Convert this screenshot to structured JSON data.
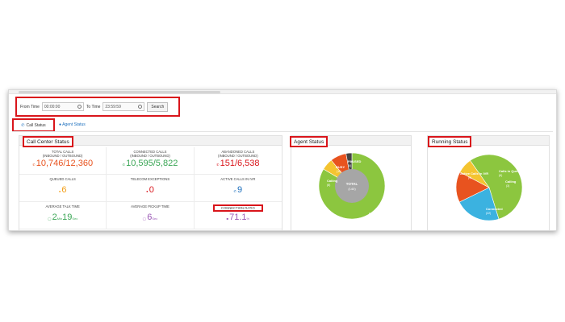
{
  "filter": {
    "from_label": "From Time",
    "from_value": "00:00:00",
    "to_label": "To Time",
    "to_value": "23:59:59",
    "search_label": "Search"
  },
  "tabs": [
    {
      "label": "Call Status",
      "icon": "phone-icon",
      "active": true
    },
    {
      "label": "Agent Status",
      "icon": "user-icon",
      "active": false
    }
  ],
  "call_center": {
    "title": "Call Center Status",
    "cells": [
      {
        "title": "TOTAL CALLS",
        "subtitle": "(INBOUND / OUTBOUND)",
        "value": "10,746/12,360",
        "color": "#e8531f",
        "icon": "phone-icon"
      },
      {
        "title": "CONNECTED CALLS",
        "subtitle": "(INBOUND / OUTBOUND)",
        "value": "10,595/5,822",
        "color": "#3aa655",
        "icon": "phone-icon"
      },
      {
        "title": "ABANDONED CALLS",
        "subtitle": "(INBOUND / OUTBOUND)",
        "value": "151/6,538",
        "color": "#d9151b",
        "icon": "phone-icon"
      },
      {
        "title": "QUEUED CALLS",
        "subtitle": "",
        "value": "6",
        "color": "#f39c12",
        "icon": "queue-icon"
      },
      {
        "title": "TELECOM EXCEPTIONS",
        "subtitle": "",
        "value": "0",
        "color": "#d9151b",
        "icon": "alert-icon"
      },
      {
        "title": "ACTIVE CALLS IN IVR",
        "subtitle": "",
        "value": "9",
        "color": "#1a6ebd",
        "icon": "phone-icon"
      },
      {
        "title": "AVERAGE TALK TIME",
        "subtitle": "",
        "value": "2",
        "unit1": "Min",
        "value2": "19",
        "unit2": "Sec",
        "color": "#3aa655",
        "icon": "clock-icon"
      },
      {
        "title": "AVERAGE PICKUP TIME",
        "subtitle": "",
        "value": "6",
        "unit1": "Sec",
        "color": "#9b59b6",
        "icon": "clock-icon"
      },
      {
        "title": "CONNECTION RATIO",
        "subtitle": "",
        "value": "71.1",
        "unit1": "%",
        "color": "#9b59b6",
        "icon": "chart-icon"
      }
    ]
  },
  "agent_status": {
    "title": "Agent Status",
    "center_label": "TOTAL",
    "center_value": "(140)",
    "slices": [
      {
        "label": "READY",
        "value": 117,
        "display": "(117)",
        "color": "#8cc63f"
      },
      {
        "label": "Calling",
        "value": 8,
        "display": "(8)",
        "color": "#f4c430"
      },
      {
        "label": "BUSY",
        "value": 11,
        "display": "(11)",
        "color": "#e8531f"
      },
      {
        "label": "PAUSED",
        "value": 4,
        "display": "(4)",
        "color": "#444444"
      }
    ]
  },
  "running_status": {
    "title": "Running Status",
    "slices": [
      {
        "label": "Connected",
        "value": 22,
        "display": "(22)",
        "color": "#8cc63f"
      },
      {
        "label": "Active Calls in IVR",
        "value": 9,
        "display": "(9)",
        "color": "#3bb2e0"
      },
      {
        "label": "Calls in Queue",
        "value": 6,
        "display": "(6)",
        "color": "#e8531f"
      },
      {
        "label": "Calling",
        "value": 3,
        "display": "(3)",
        "color": "#f4c430"
      }
    ]
  }
}
